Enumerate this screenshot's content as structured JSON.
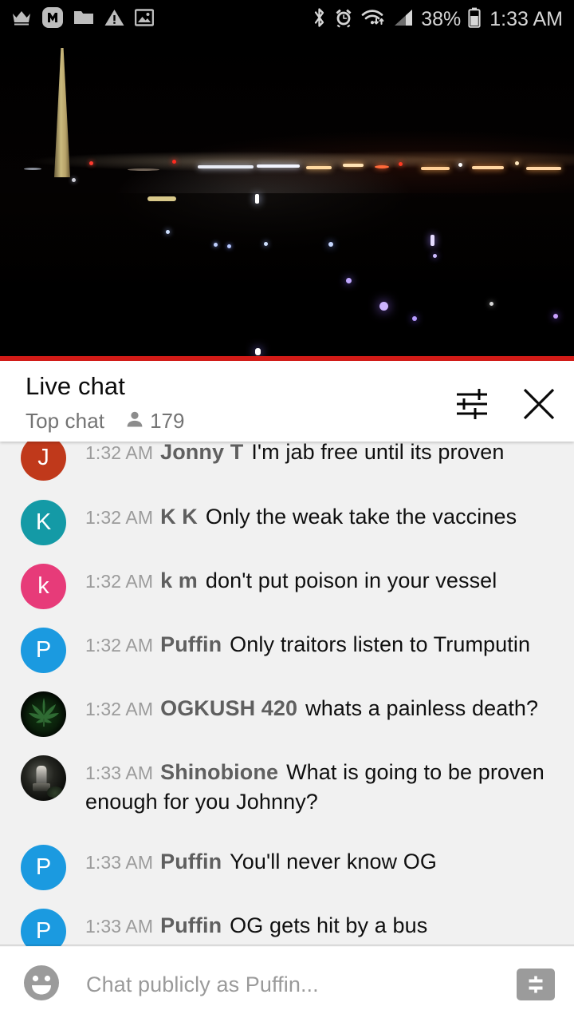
{
  "statusbar": {
    "left_icons": [
      "crown-icon",
      "circled-m-icon",
      "folder-icon",
      "warning-triangle-icon",
      "image-icon"
    ],
    "right_icons": [
      "bluetooth-icon",
      "alarm-clock-icon",
      "wifi-icon",
      "cell-signal-icon",
      "battery-icon"
    ],
    "battery_percent": "38%",
    "clock": "1:33 AM"
  },
  "video": {
    "description": "washington-monument-night-livestream",
    "progress_color": "#d31b17"
  },
  "chat_header": {
    "title": "Live chat",
    "mode": "Top chat",
    "viewer_icon": "person-icon",
    "viewer_count": "179",
    "settings_icon": "tune-sliders-icon",
    "close_icon": "close-icon"
  },
  "messages": [
    {
      "time": "1:32 AM",
      "author": "Jonny T",
      "text": "I'm jab free until its proven",
      "avatar_letter": "J",
      "avatar_color": "#c0391b",
      "avatar_type": "letter"
    },
    {
      "time": "1:32 AM",
      "author": "K K",
      "text": "Only the weak take the vaccines",
      "avatar_letter": "K",
      "avatar_color": "#149aa6",
      "avatar_type": "letter"
    },
    {
      "time": "1:32 AM",
      "author": "k m",
      "text": "don't put poison in your vessel",
      "avatar_letter": "k",
      "avatar_color": "#e73b79",
      "avatar_type": "letter"
    },
    {
      "time": "1:32 AM",
      "author": "Puffin",
      "text": "Only traitors listen to Trumputin",
      "avatar_letter": "P",
      "avatar_color": "#1b9ae0",
      "avatar_type": "letter"
    },
    {
      "time": "1:32 AM",
      "author": "OGKUSH 420",
      "text": "whats a painless death?",
      "avatar_letter": "",
      "avatar_color": "#000000",
      "avatar_type": "photo-leaf"
    },
    {
      "time": "1:33 AM",
      "author": "Shinobione",
      "text": "What is going to be proven enough for you Johnny?",
      "avatar_letter": "",
      "avatar_color": "#1a1a1a",
      "avatar_type": "photo-statue"
    },
    {
      "time": "1:33 AM",
      "author": "Puffin",
      "text": "You'll never know OG",
      "avatar_letter": "P",
      "avatar_color": "#1b9ae0",
      "avatar_type": "letter"
    },
    {
      "time": "1:33 AM",
      "author": "Puffin",
      "text": "OG gets hit by a bus",
      "avatar_letter": "P",
      "avatar_color": "#1b9ae0",
      "avatar_type": "letter"
    }
  ],
  "input_bar": {
    "emoji_icon": "emoji-smiley-icon",
    "placeholder": "Chat publicly as Puffin...",
    "superchat_icon": "dollar-superchat-icon"
  }
}
